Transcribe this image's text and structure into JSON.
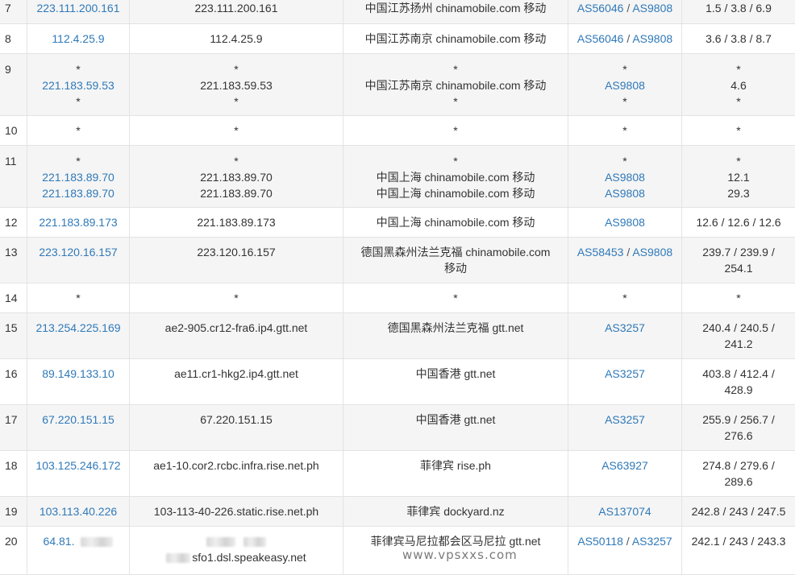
{
  "watermark": "www.vpsxxs.com",
  "rows": [
    {
      "hop": "7",
      "ip": [
        "223.111.200.161"
      ],
      "host": [
        "223.111.200.161"
      ],
      "loc": [
        "中国江苏扬州 chinamobile.com 移动"
      ],
      "as": [
        [
          "AS56046",
          "AS9808"
        ]
      ],
      "time": [
        "1.5 / 3.8 / 6.9"
      ]
    },
    {
      "hop": "8",
      "ip": [
        "112.4.25.9"
      ],
      "host": [
        "112.4.25.9"
      ],
      "loc": [
        "中国江苏南京 chinamobile.com 移动"
      ],
      "as": [
        [
          "AS56046",
          "AS9808"
        ]
      ],
      "time": [
        "3.6 / 3.8 / 8.7"
      ]
    },
    {
      "hop": "9",
      "ip": [
        "*",
        "221.183.59.53",
        "*"
      ],
      "host": [
        "*",
        "221.183.59.53",
        "*"
      ],
      "loc": [
        "*",
        "中国江苏南京 chinamobile.com 移动",
        "*"
      ],
      "as": [
        [
          "*"
        ],
        [
          "AS9808"
        ],
        [
          "*"
        ]
      ],
      "time": [
        "*",
        "4.6",
        "*"
      ]
    },
    {
      "hop": "10",
      "ip": [
        "*"
      ],
      "host": [
        "*"
      ],
      "loc": [
        "*"
      ],
      "as": [
        [
          "*"
        ]
      ],
      "time": [
        "*"
      ]
    },
    {
      "hop": "11",
      "ip": [
        "*",
        "221.183.89.70",
        "221.183.89.70"
      ],
      "host": [
        "*",
        "221.183.89.70",
        "221.183.89.70"
      ],
      "loc": [
        "*",
        "中国上海 chinamobile.com 移动",
        "中国上海 chinamobile.com 移动"
      ],
      "as": [
        [
          "*"
        ],
        [
          "AS9808"
        ],
        [
          "AS9808"
        ]
      ],
      "time": [
        "*",
        "12.1",
        "29.3"
      ]
    },
    {
      "hop": "12",
      "ip": [
        "221.183.89.173"
      ],
      "host": [
        "221.183.89.173"
      ],
      "loc": [
        "中国上海 chinamobile.com 移动"
      ],
      "as": [
        [
          "AS9808"
        ]
      ],
      "time": [
        "12.6 / 12.6 / 12.6"
      ]
    },
    {
      "hop": "13",
      "ip": [
        "223.120.16.157"
      ],
      "host": [
        "223.120.16.157"
      ],
      "loc": [
        "德国黑森州法兰克福 chinamobile.com",
        "移动"
      ],
      "as": [
        [
          "AS58453",
          "AS9808"
        ]
      ],
      "time": [
        "239.7 / 239.9 /",
        "254.1"
      ]
    },
    {
      "hop": "14",
      "ip": [
        "*"
      ],
      "host": [
        "*"
      ],
      "loc": [
        "*"
      ],
      "as": [
        [
          "*"
        ]
      ],
      "time": [
        "*"
      ]
    },
    {
      "hop": "15",
      "ip": [
        "213.254.225.169"
      ],
      "host": [
        "ae2-905.cr12-fra6.ip4.gtt.net"
      ],
      "loc": [
        "德国黑森州法兰克福 gtt.net"
      ],
      "as": [
        [
          "AS3257"
        ]
      ],
      "time": [
        "240.4 / 240.5 /",
        "241.2"
      ]
    },
    {
      "hop": "16",
      "ip": [
        "89.149.133.10"
      ],
      "host": [
        "ae11.cr1-hkg2.ip4.gtt.net"
      ],
      "loc": [
        "中国香港 gtt.net"
      ],
      "as": [
        [
          "AS3257"
        ]
      ],
      "time": [
        "403.8 / 412.4 /",
        "428.9"
      ]
    },
    {
      "hop": "17",
      "ip": [
        "67.220.151.15"
      ],
      "host": [
        "67.220.151.15"
      ],
      "loc": [
        "中国香港 gtt.net"
      ],
      "as": [
        [
          "AS3257"
        ]
      ],
      "time": [
        "255.9 / 256.7 /",
        "276.6"
      ]
    },
    {
      "hop": "18",
      "ip": [
        "103.125.246.172"
      ],
      "host": [
        "ae1-10.cor2.rcbc.infra.rise.net.ph"
      ],
      "loc": [
        "菲律宾 rise.ph"
      ],
      "as": [
        [
          "AS63927"
        ]
      ],
      "time": [
        "274.8 / 279.6 /",
        "289.6"
      ]
    },
    {
      "hop": "19",
      "ip": [
        "103.113.40.226"
      ],
      "host": [
        "103-113-40-226.static.rise.net.ph"
      ],
      "loc": [
        "菲律宾 dockyard.nz"
      ],
      "as": [
        [
          "AS137074"
        ]
      ],
      "time": [
        "242.8 / 243 / 247.5"
      ]
    },
    {
      "hop": "20",
      "ip": [
        "64.81."
      ],
      "host": [
        "",
        "sfo1.dsl.speakeasy.net"
      ],
      "loc": [
        "菲律宾马尼拉都会区马尼拉 gtt.net"
      ],
      "as": [
        [
          "AS50118",
          "AS3257"
        ]
      ],
      "time": [
        "242.1 / 243 / 243.3"
      ]
    }
  ]
}
